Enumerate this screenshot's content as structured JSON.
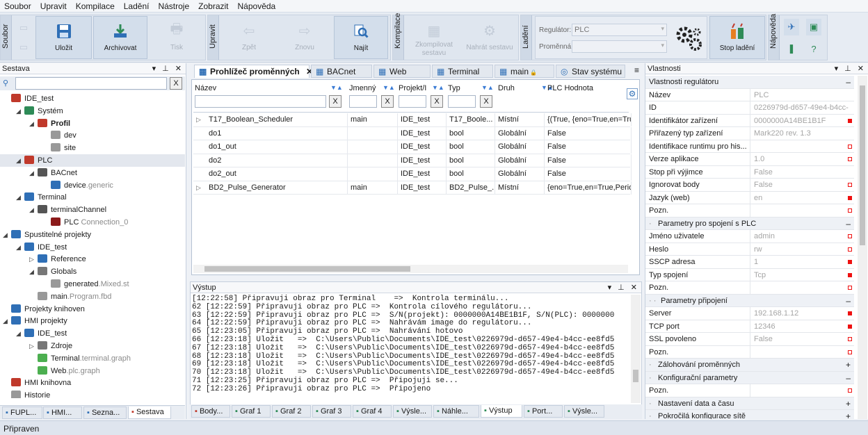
{
  "menu": [
    "Soubor",
    "Upravit",
    "Kompilace",
    "Ladění",
    "Nástroje",
    "Zobrazit",
    "Nápověda"
  ],
  "ribbon": {
    "groups": {
      "soubor": "Soubor",
      "upravit": "Upravit",
      "kompilace": "Kompilace",
      "ladeni": "Ladění",
      "napoveda": "Nápověda"
    },
    "save": "Uložit",
    "archive": "Archivovat",
    "print": "Tisk",
    "back": "Zpět",
    "forward": "Znovu",
    "find": "Najít",
    "compile": "Zkompilovat sestavu",
    "upload": "Nahrát sestavu",
    "regulator_label": "Regulátor:",
    "regulator_value": "PLC",
    "variable_label": "Proměnná:",
    "variable_value": "",
    "stop": "Stop ladění"
  },
  "left": {
    "title": "Sestava",
    "filter_value": "",
    "clear": "X",
    "tree": [
      {
        "t": "IDE_test",
        "s": "",
        "d": 0,
        "tg": "",
        "ic": "#c0392b",
        "b": false
      },
      {
        "t": "Systém",
        "s": "",
        "d": 1,
        "tg": "◢",
        "ic": "#2e8b57",
        "b": false
      },
      {
        "t": "Profil",
        "s": "",
        "d": 2,
        "tg": "◢",
        "ic": "#c0392b",
        "b": true
      },
      {
        "t": "dev",
        "s": "",
        "d": 3,
        "tg": "",
        "ic": "#999",
        "b": false
      },
      {
        "t": "site",
        "s": "",
        "d": 3,
        "tg": "",
        "ic": "#999",
        "b": false
      },
      {
        "t": "PLC",
        "s": "",
        "d": 1,
        "tg": "◢",
        "ic": "#c0392b",
        "b": false,
        "sel": true
      },
      {
        "t": "BACnet",
        "s": "",
        "d": 2,
        "tg": "◢",
        "ic": "#555",
        "b": false
      },
      {
        "t": "device",
        "s": ".generic",
        "d": 3,
        "tg": "",
        "ic": "#2f6fb6",
        "b": false
      },
      {
        "t": "Terminal",
        "s": "",
        "d": 1,
        "tg": "◢",
        "ic": "#2f6fb6",
        "b": false
      },
      {
        "t": "terminalChannel",
        "s": "",
        "d": 2,
        "tg": "◢",
        "ic": "#555",
        "b": false
      },
      {
        "t": "PLC",
        "s": " Connection_0",
        "d": 3,
        "tg": "",
        "ic": "#8b1a1a",
        "b": false
      },
      {
        "t": "Spustitelné projekty",
        "s": "",
        "d": 0,
        "tg": "◢",
        "ic": "#2f6fb6",
        "b": false
      },
      {
        "t": "IDE_test",
        "s": "",
        "d": 1,
        "tg": "◢",
        "ic": "#2f6fb6",
        "b": false
      },
      {
        "t": "Reference",
        "s": "",
        "d": 2,
        "tg": "▷",
        "ic": "#2f6fb6",
        "b": false
      },
      {
        "t": "Globals",
        "s": "",
        "d": 2,
        "tg": "◢",
        "ic": "#777",
        "b": false
      },
      {
        "t": "generated",
        "s": ".Mixed.st",
        "d": 3,
        "tg": "",
        "ic": "#999",
        "b": false
      },
      {
        "t": "main",
        "s": ".Program.fbd",
        "d": 2,
        "tg": "",
        "ic": "#999",
        "b": false
      },
      {
        "t": "Projekty knihoven",
        "s": "",
        "d": 0,
        "tg": "",
        "ic": "#2f6fb6",
        "b": false
      },
      {
        "t": "HMI projekty",
        "s": "",
        "d": 0,
        "tg": "◢",
        "ic": "#2f6fb6",
        "b": false
      },
      {
        "t": "IDE_test",
        "s": "",
        "d": 1,
        "tg": "◢",
        "ic": "#2f6fb6",
        "b": false
      },
      {
        "t": "Zdroje",
        "s": "",
        "d": 2,
        "tg": "▷",
        "ic": "#777",
        "b": false
      },
      {
        "t": "Terminal",
        "s": ".terminal.graph",
        "d": 2,
        "tg": "",
        "ic": "#4caf50",
        "b": false
      },
      {
        "t": "Web",
        "s": ".plc.graph",
        "d": 2,
        "tg": "",
        "ic": "#4caf50",
        "b": false
      },
      {
        "t": "HMI knihovna",
        "s": "",
        "d": 0,
        "tg": "",
        "ic": "#c0392b",
        "b": false
      },
      {
        "t": "Historie",
        "s": "",
        "d": 0,
        "tg": "",
        "ic": "#999",
        "b": false
      }
    ],
    "tabs": [
      "FUPL...",
      "HMI...",
      "Sezna...",
      "Sestava"
    ]
  },
  "center": {
    "tabs": [
      "Prohlížeč proměnných",
      "BACnet",
      "Web",
      "Terminal",
      "main",
      "Stav systému"
    ],
    "columns": [
      "Název",
      "Jmenný",
      "Projekt/I",
      "Typ",
      "Druh",
      "PLC Hodnota"
    ],
    "filter_clear": "X",
    "rows": [
      {
        "n": "T17_Boolean_Scheduler",
        "j": "main",
        "p": "IDE_test",
        "t": "T17_Boole...",
        "d": "Místní",
        "v": "{(True, {eno=True,en=Tru",
        "e": true
      },
      {
        "n": "do1",
        "j": "",
        "p": "IDE_test",
        "t": "bool",
        "d": "Globální",
        "v": "False",
        "e": false
      },
      {
        "n": "do1_out",
        "j": "",
        "p": "IDE_test",
        "t": "bool",
        "d": "Globální",
        "v": "False",
        "e": false
      },
      {
        "n": "do2",
        "j": "",
        "p": "IDE_test",
        "t": "bool",
        "d": "Globální",
        "v": "False",
        "e": false
      },
      {
        "n": "do2_out",
        "j": "",
        "p": "IDE_test",
        "t": "bool",
        "d": "Globální",
        "v": "False",
        "e": false
      },
      {
        "n": "BD2_Pulse_Generator",
        "j": "main",
        "p": "IDE_test",
        "t": "BD2_Pulse_...",
        "d": "Místní",
        "v": "{eno=True,en=True,Perio",
        "e": true
      }
    ]
  },
  "output": {
    "title": "Výstup",
    "lines": [
      "[12:22:58] Připravuji obraz pro Terminal    =>  Kontrola terminálu...",
      "62 [12:22:59] Připravuji obraz pro PLC =>  Kontrola cílového regulátoru...",
      "63 [12:22:59] Připravuji obraz pro PLC =>  S/N(projekt): 0000000A14BE1B1F, S/N(PLC): 0000000",
      "64 [12:22:59] Připravuji obraz pro PLC =>  Nahrávám image do regulátoru...",
      "65 [12:23:05] Připravuji obraz pro PLC =>  Nahrávání hotovo",
      "66 [12:23:18] Uložit   =>  C:\\Users\\Public\\Documents\\IDE_test\\0226979d-d657-49e4-b4cc-ee8fd5",
      "67 [12:23:18] Uložit   =>  C:\\Users\\Public\\Documents\\IDE_test\\0226979d-d657-49e4-b4cc-ee8fd5",
      "68 [12:23:18] Uložit   =>  C:\\Users\\Public\\Documents\\IDE_test\\0226979d-d657-49e4-b4cc-ee8fd5",
      "69 [12:23:18] Uložit   =>  C:\\Users\\Public\\Documents\\IDE_test\\0226979d-d657-49e4-b4cc-ee8fd5",
      "70 [12:23:18] Uložit   =>  C:\\Users\\Public\\Documents\\IDE_test\\0226979d-d657-49e4-b4cc-ee8fd5",
      "71 [12:23:25] Připravuji obraz pro PLC =>  Připojuji se...",
      "72 [12:23:26] Připravuji obraz pro PLC =>  Připojeno"
    ],
    "tabs": [
      "Body...",
      "Graf 1",
      "Graf 2",
      "Graf 3",
      "Graf 4",
      "Výsle...",
      "Náhle...",
      "Výstup",
      "Port...",
      "Výsle..."
    ]
  },
  "right": {
    "title": "Vlastnosti",
    "rows": [
      {
        "k": "Vlastnosti regulátoru",
        "v": "",
        "sec": true,
        "tog": "–",
        "m": ""
      },
      {
        "k": "Název",
        "v": "PLC",
        "m": ""
      },
      {
        "k": "ID",
        "v": "0226979d-d657-49e4-b4cc-...",
        "m": ""
      },
      {
        "k": "Identifikátor zařízení",
        "v": "0000000A14BE1B1F",
        "m": "f"
      },
      {
        "k": "Přiřazený typ zařízení",
        "v": "Mark220 rev. 1.3",
        "m": ""
      },
      {
        "k": "Identifikace runtimu pro his...",
        "v": "",
        "m": "o"
      },
      {
        "k": "Verze aplikace",
        "v": "1.0",
        "m": "o"
      },
      {
        "k": "Stop při výjimce",
        "v": "False",
        "m": ""
      },
      {
        "k": "Ignorovat body",
        "v": "False",
        "m": "o"
      },
      {
        "k": "Jazyk (web)",
        "v": "en",
        "m": "f"
      },
      {
        "k": "Pozn.",
        "v": "",
        "m": "o"
      },
      {
        "k": "Parametry pro spojení s PLC",
        "v": "",
        "sec": true,
        "tog": "–",
        "m": ""
      },
      {
        "k": "Jméno uživatele",
        "v": "admin",
        "m": "o"
      },
      {
        "k": "Heslo",
        "v": "rw",
        "m": "o"
      },
      {
        "k": "SSCP adresa",
        "v": "1",
        "m": "f"
      },
      {
        "k": "Typ spojení",
        "v": "Tcp",
        "m": "f"
      },
      {
        "k": "Pozn.",
        "v": "",
        "m": "o"
      },
      {
        "k": "Parametry připojení",
        "v": "",
        "sec": true,
        "tog": "–",
        "m": ""
      },
      {
        "k": "Server",
        "v": "192.168.1.12",
        "m": "f"
      },
      {
        "k": "TCP port",
        "v": "12346",
        "m": "f"
      },
      {
        "k": "SSL povoleno",
        "v": "False",
        "m": "o"
      },
      {
        "k": "Pozn.",
        "v": "",
        "m": "o"
      },
      {
        "k": "Zálohování proměnných",
        "v": "",
        "sec": true,
        "tog": "+",
        "m": ""
      },
      {
        "k": "Konfigurační parametry",
        "v": "",
        "sec": true,
        "tog": "–",
        "m": ""
      },
      {
        "k": "Pozn.",
        "v": "",
        "m": "o"
      },
      {
        "k": "Nastavení data a času",
        "v": "",
        "sec": true,
        "tog": "+",
        "m": ""
      },
      {
        "k": "Pokročilá konfigurace sítě",
        "v": "",
        "sec": true,
        "tog": "+",
        "m": ""
      }
    ]
  },
  "status": "Připraven"
}
